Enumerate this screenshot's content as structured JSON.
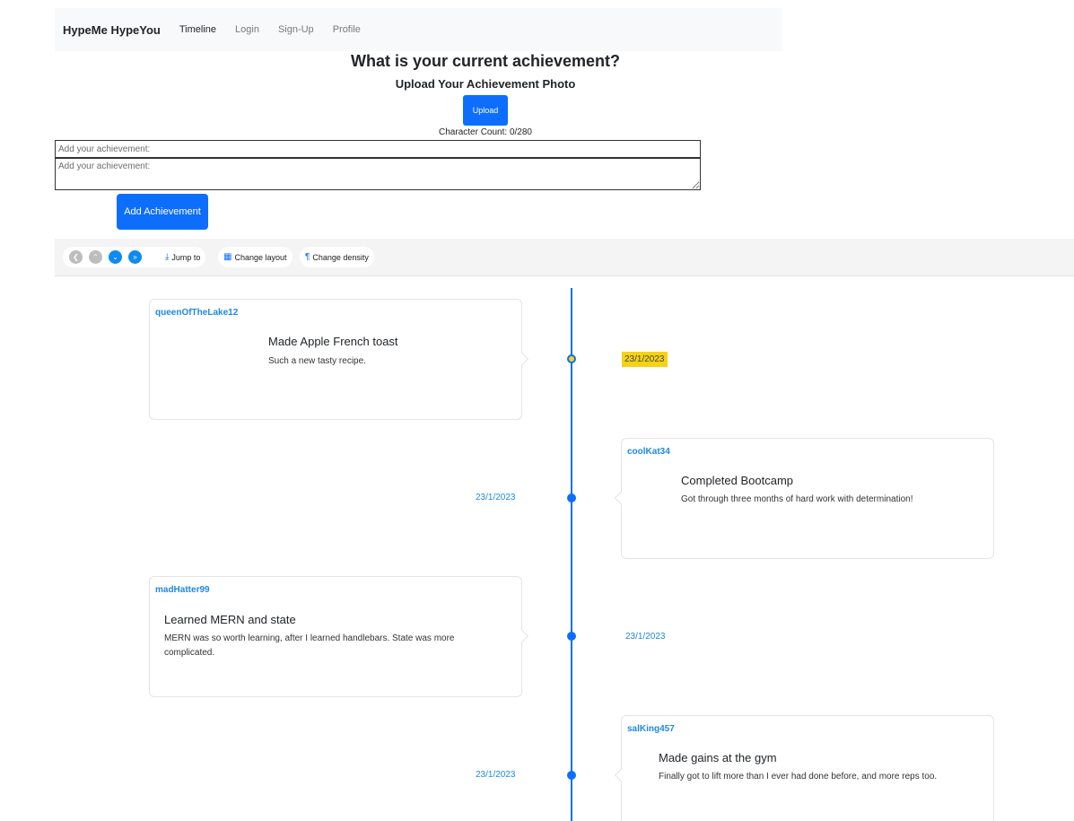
{
  "nav": {
    "brand": "HypeMe HypeYou",
    "links": [
      "Timeline",
      "Login",
      "Sign-Up",
      "Profile"
    ]
  },
  "form": {
    "heading": "What is your current achievement?",
    "upload_heading": "Upload Your Achievement Photo",
    "upload_button": "Upload",
    "char_count": "Character Count: 0/280",
    "input_placeholder": "Add your achievement:",
    "textarea_placeholder": "Add your achievement:",
    "add_button": "Add Achievement"
  },
  "toolbar": {
    "jump_to": "Jump to",
    "change_layout": "Change layout",
    "change_density": "Change density"
  },
  "timeline": {
    "items": [
      {
        "user": "queenOfTheLake12",
        "title": "Made Apple French toast",
        "description": "Such a new tasty recipe.",
        "date": "23/1/2023"
      },
      {
        "user": "coolKat34",
        "title": "Completed Bootcamp",
        "description": "Got through three months of hard work with determination!",
        "date": "23/1/2023"
      },
      {
        "user": "madHatter99",
        "title": "Learned MERN and state",
        "description": "MERN was so worth learning, after I learned handlebars. State was more complicated.",
        "date": "23/1/2023"
      },
      {
        "user": "salKing457",
        "title": "Made gains at the gym",
        "description": "Finally got to lift more than I ever had done before, and more reps too.",
        "date": "23/1/2023"
      }
    ]
  },
  "colors": {
    "primary": "#0d6efd",
    "accent_yellow": "#f5d312",
    "link_blue": "#1e88e5"
  }
}
